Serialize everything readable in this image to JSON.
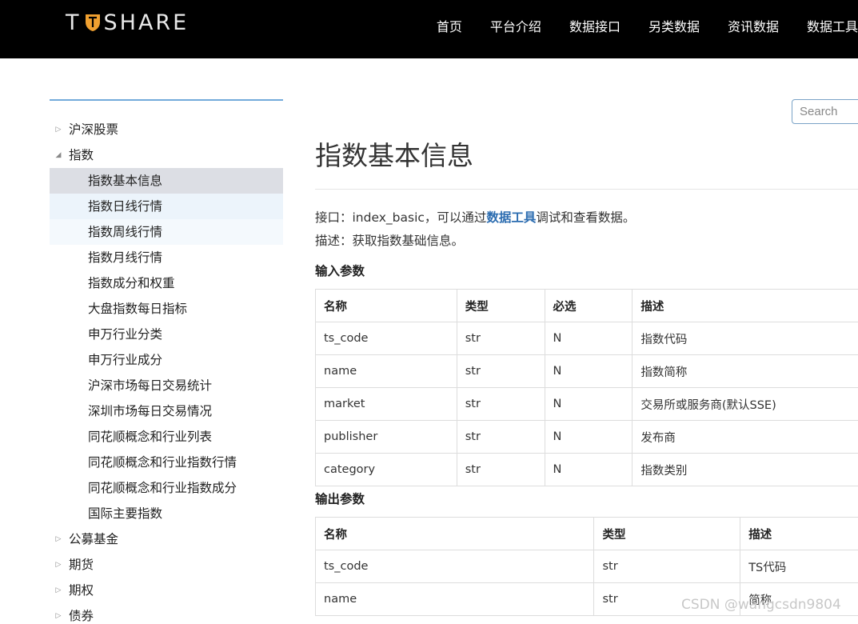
{
  "header": {
    "logo_left": "T",
    "logo_right": "SHARE",
    "nav": [
      "首页",
      "平台介绍",
      "数据接口",
      "另类数据",
      "资讯数据",
      "数据工具"
    ]
  },
  "search": {
    "placeholder": "Search"
  },
  "sidebar": {
    "items": [
      {
        "label": "沪深股票",
        "level": 0,
        "arrow": "▷"
      },
      {
        "label": "指数",
        "level": 0,
        "arrow": "◢"
      },
      {
        "label": "指数基本信息",
        "level": 1,
        "state": "active"
      },
      {
        "label": "指数日线行情",
        "level": 1,
        "state": "hover1"
      },
      {
        "label": "指数周线行情",
        "level": 1,
        "state": "hover2"
      },
      {
        "label": "指数月线行情",
        "level": 1
      },
      {
        "label": "指数成分和权重",
        "level": 1
      },
      {
        "label": "大盘指数每日指标",
        "level": 1
      },
      {
        "label": "申万行业分类",
        "level": 1
      },
      {
        "label": "申万行业成分",
        "level": 1
      },
      {
        "label": "沪深市场每日交易统计",
        "level": 1
      },
      {
        "label": "深圳市场每日交易情况",
        "level": 1
      },
      {
        "label": "同花顺概念和行业列表",
        "level": 1
      },
      {
        "label": "同花顺概念和行业指数行情",
        "level": 1
      },
      {
        "label": "同花顺概念和行业指数成分",
        "level": 1
      },
      {
        "label": "国际主要指数",
        "level": 1
      },
      {
        "label": "公募基金",
        "level": 0,
        "arrow": "▷"
      },
      {
        "label": "期货",
        "level": 0,
        "arrow": "▷"
      },
      {
        "label": "期权",
        "level": 0,
        "arrow": "▷"
      },
      {
        "label": "债券",
        "level": 0,
        "arrow": "▷"
      }
    ]
  },
  "main": {
    "title": "指数基本信息",
    "api_prefix": "接口：index_basic，可以通过",
    "api_link": "数据工具",
    "api_suffix": "调试和查看数据。",
    "description": "描述：获取指数基础信息。",
    "input_heading": "输入参数",
    "input_table": {
      "headers": [
        "名称",
        "类型",
        "必选",
        "描述"
      ],
      "rows": [
        [
          "ts_code",
          "str",
          "N",
          "指数代码"
        ],
        [
          "name",
          "str",
          "N",
          "指数简称"
        ],
        [
          "market",
          "str",
          "N",
          "交易所或服务商(默认SSE)"
        ],
        [
          "publisher",
          "str",
          "N",
          "发布商"
        ],
        [
          "category",
          "str",
          "N",
          "指数类别"
        ]
      ]
    },
    "output_heading": "输出参数",
    "output_table": {
      "headers": [
        "名称",
        "类型",
        "描述"
      ],
      "rows": [
        [
          "ts_code",
          "str",
          "TS代码"
        ],
        [
          "name",
          "str",
          "简称"
        ]
      ]
    }
  },
  "watermark": "CSDN @wangcsdn9804",
  "colors": {
    "topbar": "#000000",
    "link": "#2b6cb0",
    "active_bg": "#dcdee4",
    "logo_accent": "#f0a030"
  }
}
